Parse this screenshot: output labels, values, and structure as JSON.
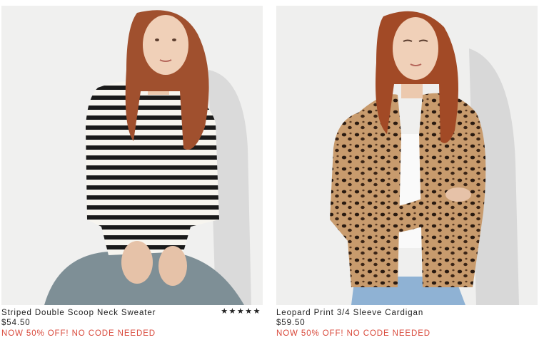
{
  "products": [
    {
      "name": "Striped Double Scoop Neck Sweater",
      "price": "$54.50",
      "promo": "NOW 50% OFF! NO CODE NEEDED",
      "rating": 5,
      "rating_glyphs": "★★★★★",
      "image_icon": "striped-sweater-model-photo"
    },
    {
      "name": "Leopard Print 3/4 Sleeve Cardigan",
      "price": "$59.50",
      "promo": "NOW 50% OFF! NO CODE NEEDED",
      "image_icon": "leopard-cardigan-model-photo"
    }
  ],
  "colors": {
    "promo": "#d94a3c",
    "text": "#222222",
    "photo_background": "#f1f1f1"
  }
}
